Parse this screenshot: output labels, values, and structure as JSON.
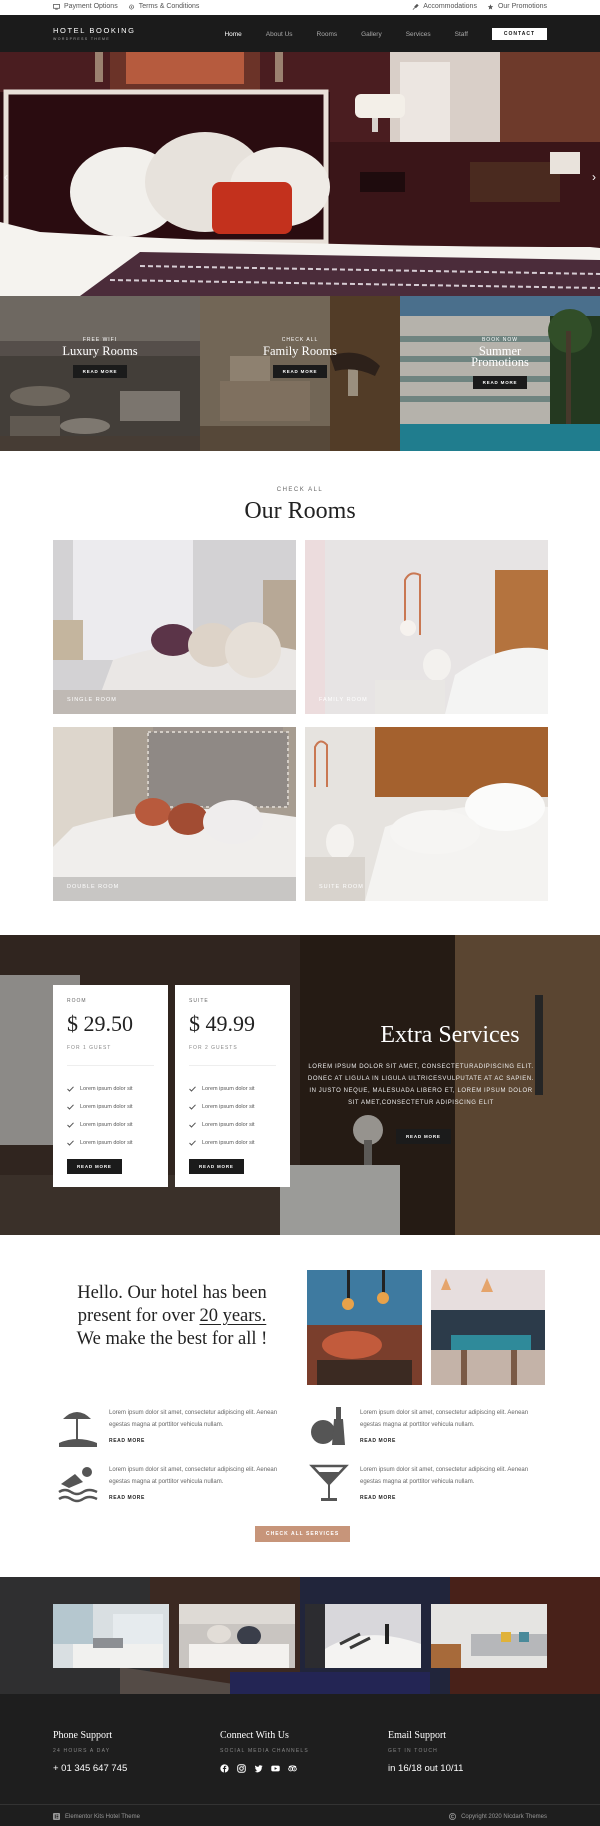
{
  "topbar": {
    "left": [
      {
        "icon": "monitor-icon",
        "label": "Payment Options"
      },
      {
        "icon": "gear-icon",
        "label": "Terms & Conditions"
      }
    ],
    "right": [
      {
        "icon": "pin-icon",
        "label": "Accommodations"
      },
      {
        "icon": "star-icon",
        "label": "Our Promotions"
      }
    ]
  },
  "nav": {
    "logo_title": "HOTEL BOOKING",
    "logo_subtitle": "WORDPRESS THEME",
    "items": [
      "Home",
      "About Us",
      "Rooms",
      "Gallery",
      "Services",
      "Staff"
    ],
    "active": "Home",
    "contact": "CONTACT"
  },
  "hero": {
    "prev": "‹",
    "next": "›"
  },
  "promos": [
    {
      "kicker": "FREE WIFI",
      "title": "Luxury Rooms",
      "button": "READ MORE"
    },
    {
      "kicker": "CHECK ALL",
      "title": "Family Rooms",
      "button": "READ MORE"
    },
    {
      "kicker": "BOOK NOW",
      "title": "Summer Promotions",
      "button": "READ MORE"
    }
  ],
  "rooms": {
    "kicker": "CHECK ALL",
    "title": "Our Rooms",
    "items": [
      "SINGLE ROOM",
      "FAMILY ROOM",
      "DOUBLE ROOM",
      "SUITE ROOM"
    ]
  },
  "pricing": [
    {
      "kicker": "ROOM",
      "price": "$ 29.50",
      "guests": "FOR 1 GUEST",
      "features": [
        "Lorem ipsum dolor sit",
        "Lorem ipsum dolor sit",
        "Lorem ipsum dolor sit",
        "Lorem ipsum dolor sit"
      ],
      "button": "READ MORE"
    },
    {
      "kicker": "SUITE",
      "price": "$ 49.99",
      "guests": "FOR 2 GUESTS",
      "features": [
        "Lorem ipsum dolor sit",
        "Lorem ipsum dolor sit",
        "Lorem ipsum dolor sit",
        "Lorem ipsum dolor sit"
      ],
      "button": "READ MORE"
    }
  ],
  "extra": {
    "title": "Extra Services",
    "text": "LOREM IPSUM DOLOR SIT AMET, CONSECTETURADIPISCING ELIT. DONEC AT LIGULA IN LIGULA ULTRICESVULPUTATE AT AC SAPIEN. IN JUSTO NEQUE, MALESUADA LIBERO ET, LOREM IPSUM DOLOR SIT AMET,CONSECTETUR ADIPISCING ELIT",
    "button": "READ MORE"
  },
  "hello": {
    "before": "Hello. Our hotel has been present for over ",
    "underlined": "20 years.",
    "after": " We make the best for all !"
  },
  "features": [
    {
      "icon": "beach-umbrella-icon",
      "text": "Lorem ipsum dolor sit amet, consectetur adipiscing elit. Aenean egestas magna at porttitor vehicula nullam.",
      "link": "READ MORE"
    },
    {
      "icon": "wine-bottle-icon",
      "text": "Lorem ipsum dolor sit amet, consectetur adipiscing elit. Aenean egestas magna at porttitor vehicula nullam.",
      "link": "READ MORE"
    },
    {
      "icon": "swimmer-icon",
      "text": "Lorem ipsum dolor sit amet, consectetur adipiscing elit. Aenean egestas magna at porttitor vehicula nullam.",
      "link": "READ MORE"
    },
    {
      "icon": "cocktail-icon",
      "text": "Lorem ipsum dolor sit amet, consectetur adipiscing elit. Aenean egestas magna at porttitor vehicula nullam.",
      "link": "READ MORE"
    }
  ],
  "cta": "CHECK ALL SERVICES",
  "footer": {
    "columns": [
      {
        "heading": "Phone Support",
        "sub": "24 HOURS A DAY",
        "value": "+ 01 345 647 745"
      },
      {
        "heading": "Connect With Us",
        "sub": "SOCIAL MEDIA CHANNELS",
        "social": [
          "facebook-icon",
          "instagram-icon",
          "twitter-icon",
          "youtube-icon",
          "tripadvisor-icon"
        ]
      },
      {
        "heading": "Email Support",
        "sub": "GET IN TOUCH",
        "value": "in 16/18 out 10/11"
      }
    ],
    "left": "Elementor Kits Hotel Theme",
    "right": "Copyright 2020 Nicdark Themes"
  },
  "colors": {
    "dark": "#1b1b1b",
    "accent": "#c7957a",
    "footer": "#1e1e1e"
  }
}
